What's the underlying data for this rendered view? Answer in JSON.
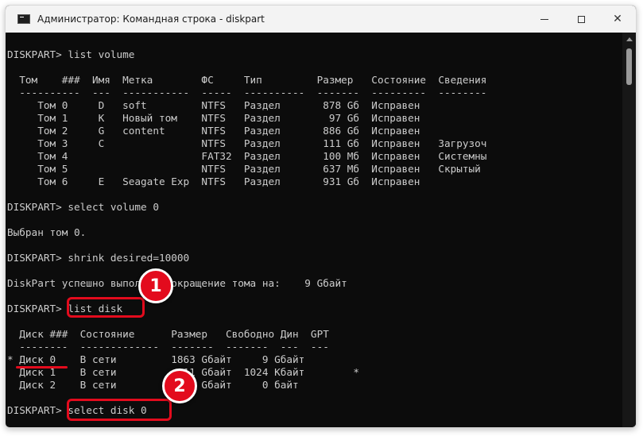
{
  "window": {
    "title": "Администратор: Командная строка - diskpart",
    "minimize_glyph": "—",
    "close_glyph": "✕"
  },
  "terminal": {
    "lines": [
      "",
      "DISKPART> list volume",
      "",
      "  Том    ###  Имя  Метка        ФС     Тип         Размер   Состояние  Сведения",
      "  ----------  ---  -----------  -----  ----------  -------  ---------  --------",
      "     Том 0     D   soft         NTFS   Раздел       878 Gб  Исправен",
      "     Том 1     K   Новый том    NTFS   Раздел        97 Gб  Исправен",
      "     Том 2     G   content      NTFS   Раздел       886 Gб  Исправен",
      "     Том 3     C                NTFS   Раздел       111 Gб  Исправен   Загрузоч",
      "     Том 4                      FAT32  Раздел       100 Мб  Исправен   Системны",
      "     Том 5                      NTFS   Раздел       637 Мб  Исправен   Скрытый",
      "     Том 6     E   Seagate Exp  NTFS   Раздел       931 Gб  Исправен",
      "",
      "DISKPART> select volume 0",
      "",
      "Выбран том 0.",
      "",
      "DISKPART> shrink desired=10000",
      "",
      "DiskPart успешно выполнил сокращение тома на:    9 Gбайт",
      "",
      "DISKPART> list disk",
      "",
      "  Диск ###  Состояние      Размер   Свободно Дин  GPT",
      "  --------  -------------  -------  -------  ---  ---",
      "* Диск 0    В сети         1863 Gбайт     9 Gбайт",
      "  Диск 1    В сети          111 Gбайт  1024 Кбайт        *",
      "  Диск 2    В сети          931 Gбайт     0 байт",
      "",
      "DISKPART> select disk 0"
    ]
  },
  "badges": {
    "step1": "1",
    "step2": "2"
  },
  "colors": {
    "annotation_red": "#e30b1d",
    "terminal_bg": "#0c0c0c",
    "terminal_text": "#cccccc"
  }
}
